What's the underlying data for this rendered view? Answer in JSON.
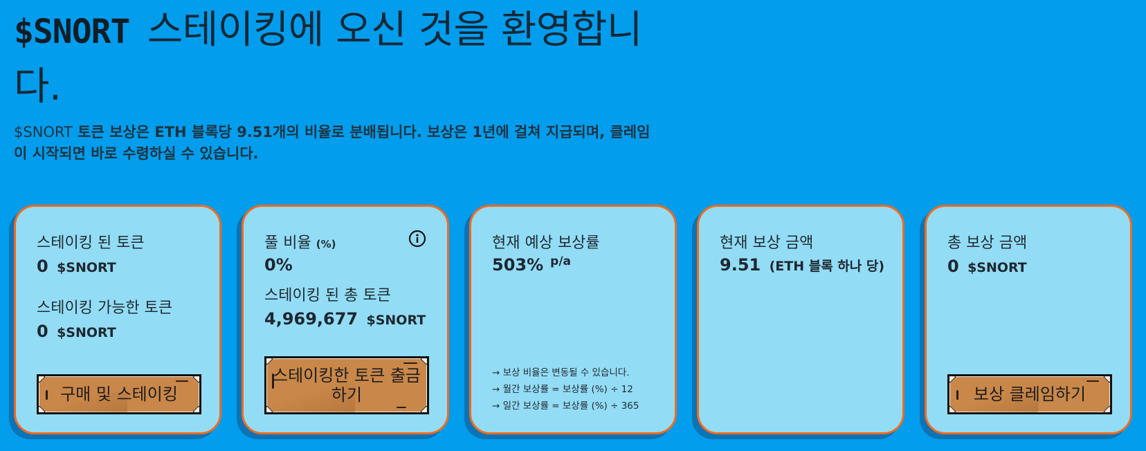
{
  "hero": {
    "brand": "$SNORT",
    "title": "스테이킹에 오신 것을 환영합니다.",
    "subtitle_lead": "$SNORT",
    "subtitle_rest": " 토큰 보상은 ETH 블록당 9.51개의 비율로 분배됩니다. 보상은 1년에 걸쳐 지급되며, 클레임이 시작되면 바로 수령하실 수 있습니다."
  },
  "cards": {
    "staked": {
      "staked_label": "스테이킹 된 토큰",
      "staked_value": "0",
      "staked_unit": "$SNORT",
      "available_label": "스테이킹 가능한 토큰",
      "available_value": "0",
      "available_unit": "$SNORT",
      "button": "구매 및 스테이킹"
    },
    "pool": {
      "ratio_label": "풀 비율",
      "ratio_suffix": "(%)",
      "ratio_value": "0%",
      "total_label": "스테이킹 된 총 토큰",
      "total_value": "4,969,677",
      "total_unit": "$SNORT",
      "button": "스테이킹한 토큰 출금하기",
      "info_icon": "info-icon"
    },
    "apy": {
      "label": "현재 예상 보상률",
      "value": "503%",
      "suffix": "p/a",
      "notes": [
        "→ 보상 비율은 변동될 수 있습니다.",
        "→ 월간 보상률 = 보상률 (%) ÷ 12",
        "→ 일간 보상률 = 보상률 (%) ÷ 365"
      ]
    },
    "current_reward": {
      "label": "현재 보상 금액",
      "value": "9.51",
      "unit": "(ETH 블록 하나 당)"
    },
    "total_reward": {
      "label": "총 보상 금액",
      "value": "0",
      "unit": "$SNORT",
      "button": "보상 클레임하기"
    }
  },
  "colors": {
    "background": "#029ded",
    "card": "#93dcf5",
    "card_border": "#f46a1c",
    "button": "#c98749"
  }
}
